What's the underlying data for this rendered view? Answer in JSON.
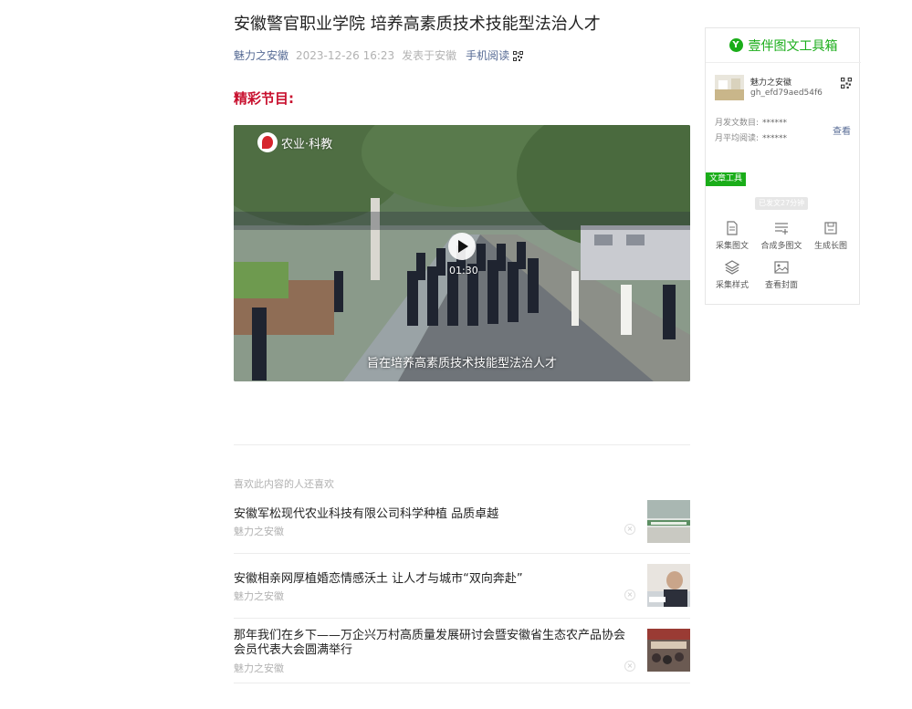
{
  "article": {
    "title": "安徽警官职业学院 培养高素质技术技能型法治人才",
    "meta": {
      "author": "魅力之安徽",
      "date": "2023-12-26 16:23",
      "published_in": "发表于安徽",
      "mobile_read": "手机阅读"
    },
    "section_heading": "精彩节目:"
  },
  "video": {
    "channel_logo_text": "农业·科教",
    "duration": "01:30",
    "subtitle": "旨在培养高素质技术技能型法治人才"
  },
  "recommendations": {
    "heading": "喜欢此内容的人还喜欢",
    "items": [
      {
        "title": "安徽军松现代农业科技有限公司科学种植 品质卓越",
        "source": "魅力之安徽"
      },
      {
        "title": "安徽相亲网厚植婚恋情感沃土 让人才与城市“双向奔赴”",
        "source": "魅力之安徽"
      },
      {
        "title": "那年我们在乡下——万企兴万村高质量发展研讨会暨安徽省生态农产品协会会员代表大会圆满举行",
        "source": "魅力之安徽"
      }
    ]
  },
  "sidebar": {
    "title": "壹伴图文工具箱",
    "logo_letter": "Y",
    "account": {
      "name": "魅力之安徽",
      "id": "gh_efd79aed54f6"
    },
    "stats": [
      {
        "label": "月发文数目:",
        "value": "******"
      },
      {
        "label": "月平均阅读:",
        "value": "******"
      }
    ],
    "view_link": "查看",
    "tools_tag": "文章工具",
    "published_note": "已发文27分钟",
    "tools": [
      {
        "label": "采集图文",
        "icon": "document-icon"
      },
      {
        "label": "合成多图文",
        "icon": "list-add-icon"
      },
      {
        "label": "生成长图",
        "icon": "save-icon"
      },
      {
        "label": "采集样式",
        "icon": "layers-icon"
      },
      {
        "label": "查看封面",
        "icon": "image-icon"
      }
    ]
  },
  "colors": {
    "accent_green": "#1aad19",
    "link_blue": "#576b95",
    "heading_red": "#c8102e"
  }
}
